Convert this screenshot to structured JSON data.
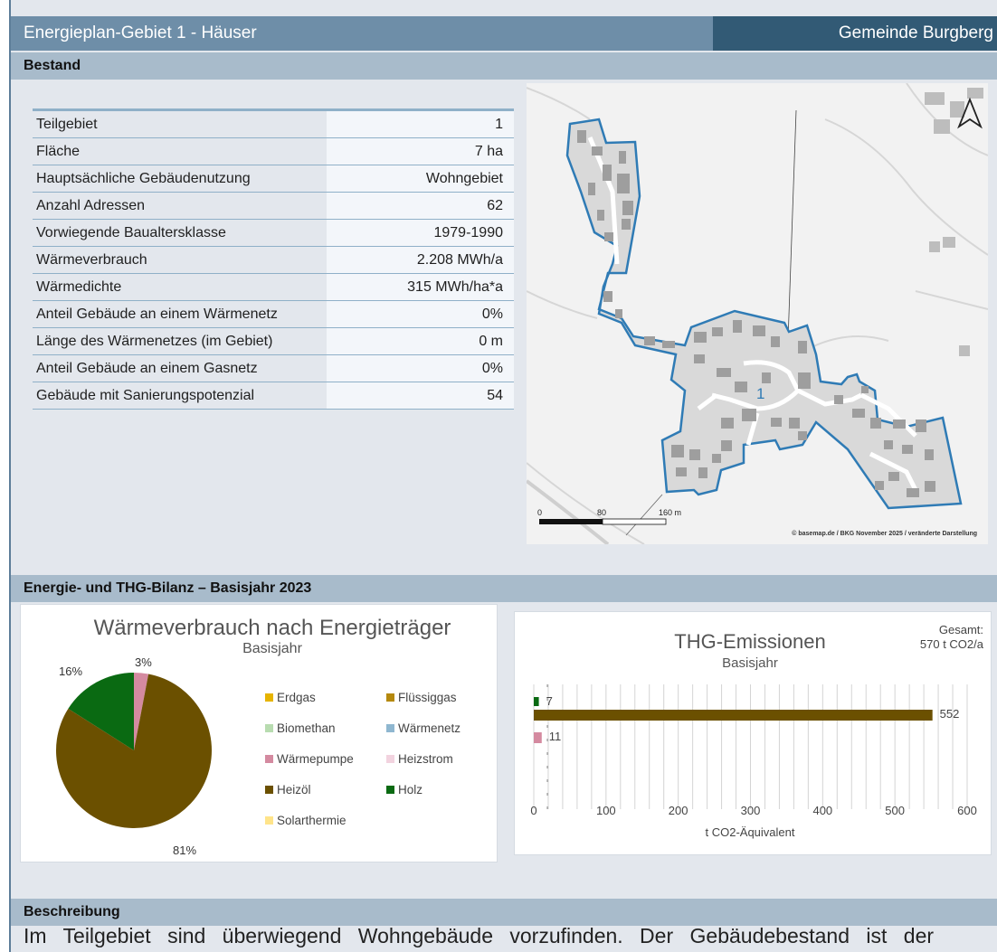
{
  "header": {
    "title": "Energieplan-Gebiet 1 - Häuser",
    "municipality": "Gemeinde Burgberg"
  },
  "sections": {
    "bestand": "Bestand",
    "bilanz": "Energie- und THG-Bilanz – Basisjahr 2023",
    "beschreibung": "Beschreibung"
  },
  "info_table": [
    {
      "label": "Teilgebiet",
      "value": "1"
    },
    {
      "label": "Fläche",
      "value": "7 ha"
    },
    {
      "label": "Hauptsächliche Gebäudenutzung",
      "value": "Wohngebiet"
    },
    {
      "label": "Anzahl Adressen",
      "value": "62"
    },
    {
      "label": "Vorwiegende Baualtersklasse",
      "value": "1979-1990"
    },
    {
      "label": "Wärmeverbrauch",
      "value": "2.208 MWh/a"
    },
    {
      "label": "Wärmedichte",
      "value": "315 MWh/ha*a"
    },
    {
      "label": "Anteil Gebäude an einem Wärmenetz",
      "value": "0%"
    },
    {
      "label": "Länge des Wärmenetzes (im Gebiet)",
      "value": "0 m"
    },
    {
      "label": "Anteil Gebäude an einem Gasnetz",
      "value": "0%"
    },
    {
      "label": "Gebäude mit Sanierungspotenzial",
      "value": "54"
    }
  ],
  "map": {
    "area_label": "1",
    "scale_labels": [
      "0",
      "80",
      "160 m"
    ],
    "credit": "© basemap.de / BKG November 2025 / veränderte Darstellung",
    "north_icon": "north-arrow-icon",
    "outline_color": "#2f7bb5"
  },
  "chart_data": [
    {
      "type": "pie",
      "title": "Wärmeverbrauch nach Energieträger",
      "subtitle": "Basisjahr",
      "slices": [
        {
          "name": "Heizöl",
          "value": 81,
          "label": "81%",
          "color": "#6b5000"
        },
        {
          "name": "Holz",
          "value": 16,
          "label": "16%",
          "color": "#0a6a12"
        },
        {
          "name": "Wärmepumpe",
          "value": 3,
          "label": "3%",
          "color": "#d48aa0"
        }
      ],
      "legend": [
        {
          "name": "Erdgas",
          "color": "#e6b400"
        },
        {
          "name": "Flüssiggas",
          "color": "#b5890e"
        },
        {
          "name": "Biomethan",
          "color": "#b8dcb0"
        },
        {
          "name": "Wärmenetz",
          "color": "#8fb7d0"
        },
        {
          "name": "Wärmepumpe",
          "color": "#d48aa0"
        },
        {
          "name": "Heizstrom",
          "color": "#f2d3df"
        },
        {
          "name": "Heizöl",
          "color": "#6b5000"
        },
        {
          "name": "Holz",
          "color": "#0a6a12"
        },
        {
          "name": "Solarthermie",
          "color": "#ffe48a"
        }
      ]
    },
    {
      "type": "bar",
      "orientation": "horizontal",
      "title": "THG-Emissionen",
      "subtitle": "Basisjahr",
      "total_label": "Gesamt:",
      "total_value": "570 t CO2/a",
      "xlabel": "t CO2-Äquivalent",
      "xlim": [
        0,
        600
      ],
      "xticks": [
        0,
        100,
        200,
        300,
        400,
        500,
        600
      ],
      "series": [
        {
          "name": "Holz",
          "value": 7,
          "color": "#0a6a12"
        },
        {
          "name": "Heizöl",
          "value": 552,
          "color": "#6b5000"
        },
        {
          "name": "Wärmepumpe",
          "value": 11,
          "color": "#d48aa0"
        }
      ]
    }
  ],
  "description": "Im Teilgebiet sind überwiegend Wohngebäude vorzufinden. Der Gebäudebestand ist der"
}
